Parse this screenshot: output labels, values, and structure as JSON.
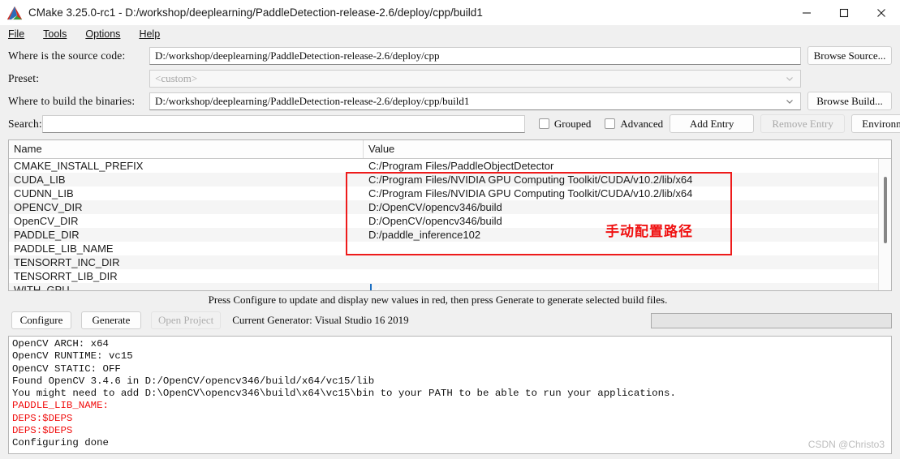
{
  "window": {
    "title": "CMake 3.25.0-rc1 - D:/workshop/deeplearning/PaddleDetection-release-2.6/deploy/cpp/build1",
    "logo": "cmake-triangle-logo",
    "minimize": "—",
    "maximize": "□",
    "close": "✕"
  },
  "menu": [
    {
      "label": "File",
      "accel": "F"
    },
    {
      "label": "Tools",
      "accel": "T"
    },
    {
      "label": "Options",
      "accel": "O"
    },
    {
      "label": "Help",
      "accel": "H"
    }
  ],
  "form": {
    "source_label": "Where is the source code:",
    "source_value": "D:/workshop/deeplearning/PaddleDetection-release-2.6/deploy/cpp",
    "browse_source_label": "Browse Source...",
    "preset_label": "Preset:",
    "preset_value": "<custom>",
    "binaries_label": "Where to build the binaries:",
    "binaries_value": "D:/workshop/deeplearning/PaddleDetection-release-2.6/deploy/cpp/build1",
    "browse_build_label": "Browse Build...",
    "search_label": "Search:",
    "search_value": "",
    "grouped_label": "Grouped",
    "grouped_checked": false,
    "advanced_label": "Advanced",
    "advanced_checked": false,
    "add_entry_label": "Add Entry",
    "remove_entry_label": "Remove Entry",
    "remove_entry_enabled": false,
    "environment_label": "Environment..."
  },
  "table": {
    "col_name": "Name",
    "col_value": "Value",
    "rows": [
      {
        "name": "CMAKE_INSTALL_PREFIX",
        "value": "C:/Program Files/PaddleObjectDetector",
        "type": "text"
      },
      {
        "name": "CUDA_LIB",
        "value": "C:/Program Files/NVIDIA GPU Computing Toolkit/CUDA/v10.2/lib/x64",
        "type": "text"
      },
      {
        "name": "CUDNN_LIB",
        "value": "C:/Program Files/NVIDIA GPU Computing Toolkit/CUDA/v10.2/lib/x64",
        "type": "text"
      },
      {
        "name": "OPENCV_DIR",
        "value": "D:/OpenCV/opencv346/build",
        "type": "text"
      },
      {
        "name": "OpenCV_DIR",
        "value": "D:/OpenCV/opencv346/build",
        "type": "text"
      },
      {
        "name": "PADDLE_DIR",
        "value": "D:/paddle_inference102",
        "type": "text"
      },
      {
        "name": "PADDLE_LIB_NAME",
        "value": "",
        "type": "text"
      },
      {
        "name": "TENSORRT_INC_DIR",
        "value": "",
        "type": "text"
      },
      {
        "name": "TENSORRT_LIB_DIR",
        "value": "",
        "type": "text"
      },
      {
        "name": "WITH_GPU",
        "value": "",
        "type": "checkbox",
        "checked": true
      }
    ],
    "annotation": "手动配置路径",
    "annotation_color": "#f01010"
  },
  "actions": {
    "hint": "Press Configure to update and display new values in red, then press Generate to generate selected build files.",
    "configure_label": "Configure",
    "generate_label": "Generate",
    "open_project_label": "Open Project",
    "open_project_enabled": false,
    "generator_text": "Current Generator: Visual Studio 16 2019",
    "progress_value": 0
  },
  "log": {
    "lines": [
      {
        "text": "OpenCV ARCH: x64",
        "color": "black"
      },
      {
        "text": "OpenCV RUNTIME: vc15",
        "color": "black"
      },
      {
        "text": "OpenCV STATIC: OFF",
        "color": "black"
      },
      {
        "text": "Found OpenCV 3.4.6 in D:/OpenCV/opencv346/build/x64/vc15/lib",
        "color": "black"
      },
      {
        "text": "You might need to add D:\\OpenCV\\opencv346\\build\\x64\\vc15\\bin to your PATH to be able to run your applications.",
        "color": "black"
      },
      {
        "text": "PADDLE_LIB_NAME:",
        "color": "red"
      },
      {
        "text": "DEPS:$DEPS",
        "color": "red"
      },
      {
        "text": "DEPS:$DEPS",
        "color": "red"
      },
      {
        "text": "Configuring done",
        "color": "black"
      }
    ],
    "watermark": "CSDN @Christo3"
  }
}
